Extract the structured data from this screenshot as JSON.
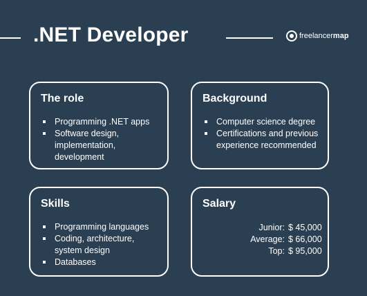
{
  "title": ".NET Developer",
  "logo": {
    "icon": "freelancermap-logo-icon",
    "text_regular": "freelancer",
    "text_bold": "map"
  },
  "colors": {
    "background": "#2b3f52",
    "foreground": "#ffffff"
  },
  "cards": {
    "role": {
      "heading": "The role",
      "items": [
        "Programming .NET apps",
        "Software design, implementation, development"
      ]
    },
    "background": {
      "heading": "Background",
      "items": [
        "Computer science degree",
        "Certifications and previous experience recommended"
      ]
    },
    "skills": {
      "heading": "Skills",
      "items": [
        "Programming languages",
        "Coding, architecture, system design",
        "Databases"
      ]
    },
    "salary": {
      "heading": "Salary",
      "rows": [
        {
          "label": "Junior:",
          "value": "$ 45,000"
        },
        {
          "label": "Average:",
          "value": "$ 66,000"
        },
        {
          "label": "Top:",
          "value": "$ 95,000"
        }
      ]
    }
  }
}
